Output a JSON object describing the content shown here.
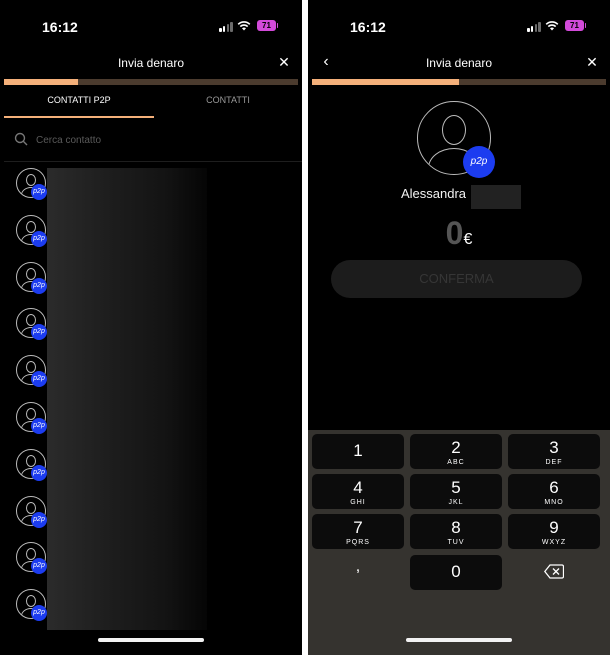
{
  "left": {
    "status": {
      "time": "16:12",
      "battery": "71"
    },
    "header": {
      "title": "Invia denaro",
      "close": "✕"
    },
    "progress": 0.25,
    "tabs": [
      {
        "label": "CONTATTI P2P",
        "active": true
      },
      {
        "label": "CONTATTI",
        "active": false
      }
    ],
    "search": {
      "placeholder": "Cerca contatto"
    },
    "contacts": [
      {
        "badge": "p2p"
      },
      {
        "badge": "p2p"
      },
      {
        "badge": "p2p"
      },
      {
        "badge": "p2p"
      },
      {
        "badge": "p2p"
      },
      {
        "badge": "p2p"
      },
      {
        "badge": "p2p"
      },
      {
        "badge": "p2p"
      },
      {
        "badge": "p2p"
      },
      {
        "badge": "p2p"
      }
    ]
  },
  "right": {
    "status": {
      "time": "16:12",
      "battery": "71"
    },
    "header": {
      "title": "Invia denaro",
      "back": "‹",
      "close": "✕"
    },
    "progress": 0.5,
    "badge": "p2p",
    "recipient_name": "Alessandra",
    "amount": "0",
    "currency": "€",
    "confirm_label": "CONFERMA",
    "keypad": [
      {
        "digit": "1",
        "letters": ""
      },
      {
        "digit": "2",
        "letters": "ABC"
      },
      {
        "digit": "3",
        "letters": "DEF"
      },
      {
        "digit": "4",
        "letters": "GHI"
      },
      {
        "digit": "5",
        "letters": "JKL"
      },
      {
        "digit": "6",
        "letters": "MNO"
      },
      {
        "digit": "7",
        "letters": "PQRS"
      },
      {
        "digit": "8",
        "letters": "TUV"
      },
      {
        "digit": "9",
        "letters": "WXYZ"
      },
      {
        "digit": ",",
        "letters": ""
      },
      {
        "digit": "0",
        "letters": ""
      }
    ]
  }
}
